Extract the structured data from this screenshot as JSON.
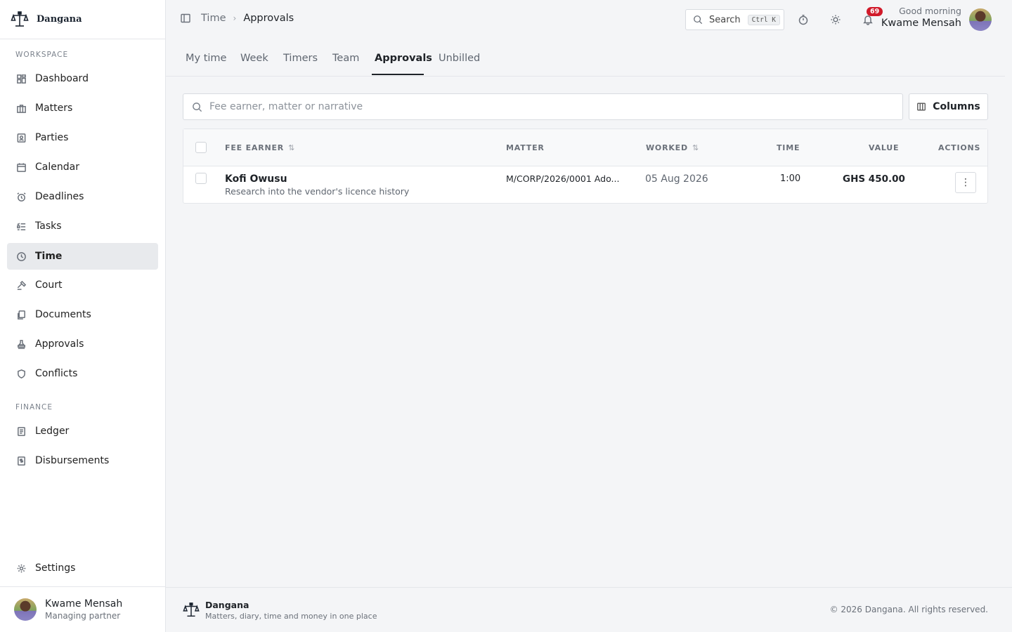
{
  "app": {
    "name": "Dangana",
    "logo_icon": "scales-icon"
  },
  "sidebar": {
    "sections": [
      {
        "label": "WORKSPACE"
      },
      {
        "label": "FINANCE"
      }
    ],
    "items": [
      {
        "label": "Dashboard",
        "icon": "dashboard-icon"
      },
      {
        "label": "Matters",
        "icon": "briefcase-icon"
      },
      {
        "label": "Parties",
        "icon": "contact-icon"
      },
      {
        "label": "Calendar",
        "icon": "calendar-icon"
      },
      {
        "label": "Deadlines",
        "icon": "alarm-icon"
      },
      {
        "label": "Tasks",
        "icon": "tasks-icon"
      },
      {
        "label": "Time",
        "icon": "clock-icon",
        "active": true
      },
      {
        "label": "Court",
        "icon": "gavel-icon"
      },
      {
        "label": "Documents",
        "icon": "documents-icon"
      },
      {
        "label": "Approvals",
        "icon": "stamp-icon"
      },
      {
        "label": "Conflicts",
        "icon": "shield-icon"
      },
      {
        "label": "Ledger",
        "icon": "ledger-icon"
      },
      {
        "label": "Disbursements",
        "icon": "receipt-icon"
      }
    ],
    "settings": {
      "label": "Settings",
      "icon": "gear-icon"
    },
    "user": {
      "name": "Kwame Mensah",
      "role": "Managing partner"
    }
  },
  "topbar": {
    "breadcrumb": [
      "Time",
      "Approvals"
    ],
    "search": {
      "label": "Search",
      "shortcut": "Ctrl K"
    },
    "notifications": {
      "count": "69"
    },
    "greeting": "Good morning",
    "user_name": "Kwame Mensah"
  },
  "tabs": [
    {
      "label": "My time"
    },
    {
      "label": "Week"
    },
    {
      "label": "Timers"
    },
    {
      "label": "Team"
    },
    {
      "label": "Approvals",
      "active": true
    },
    {
      "label": "Unbilled"
    }
  ],
  "filter": {
    "placeholder": "Fee earner, matter or narrative",
    "value": ""
  },
  "columns_button": {
    "label": "Columns"
  },
  "table": {
    "headers": {
      "fee_earner": "FEE EARNER",
      "matter": "MATTER",
      "worked": "WORKED",
      "time": "TIME",
      "value": "VALUE",
      "actions": "ACTIONS"
    },
    "rows": [
      {
        "fee_earner": "Kofi Owusu",
        "narrative": "Research into the vendor's licence history",
        "matter": "M/CORP/2026/0001 Ado...",
        "worked": "05 Aug 2026",
        "time": "1:00",
        "value": "GHS 450.00"
      }
    ]
  },
  "footer": {
    "brand": "Dangana",
    "tagline": "Matters, diary, time and money in one place",
    "copyright": "© 2026 Dangana. All rights reserved."
  },
  "colors": {
    "accent": "#1f2328",
    "badge": "#d11a2a",
    "active_nav_bg": "#e8eaed"
  }
}
